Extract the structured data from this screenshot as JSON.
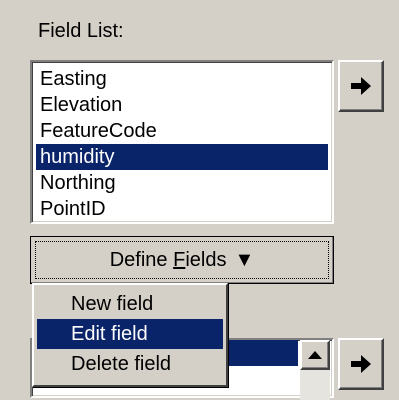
{
  "field_list": {
    "label": "Field List:",
    "items": [
      {
        "label": "Easting",
        "selected": false
      },
      {
        "label": "Elevation",
        "selected": false
      },
      {
        "label": "FeatureCode",
        "selected": false
      },
      {
        "label": "humidity",
        "selected": true
      },
      {
        "label": "Northing",
        "selected": false
      },
      {
        "label": "PointID",
        "selected": false
      }
    ]
  },
  "define_fields": {
    "label_prefix": "Define ",
    "label_accel": "F",
    "label_suffix": "ields",
    "dropdown_glyph": "▼"
  },
  "menu": {
    "items": [
      {
        "label": "New field",
        "highlighted": false
      },
      {
        "label": "Edit field",
        "highlighted": true
      },
      {
        "label": "Delete field",
        "highlighted": false
      }
    ]
  },
  "icons": {
    "add_arrow": "right-arrow-icon",
    "scroll_up": "up-arrow-icon"
  },
  "colors": {
    "face": "#d4d0c8",
    "selection": "#0a246a"
  }
}
